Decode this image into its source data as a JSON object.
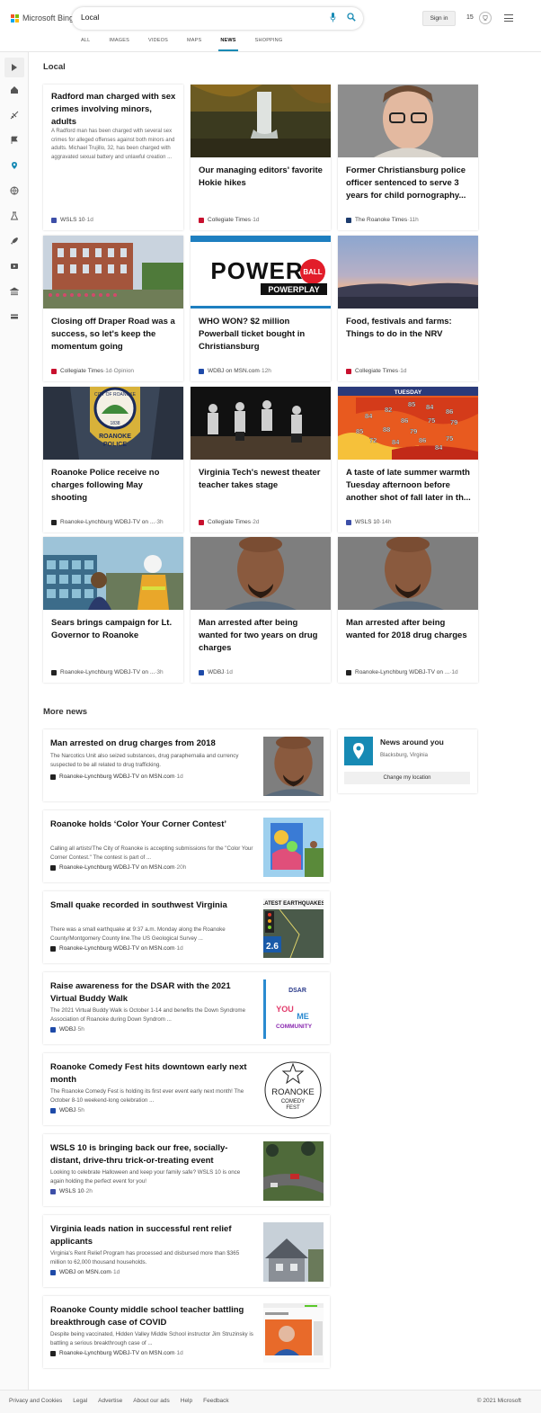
{
  "brand": {
    "name": "Microsoft Bing",
    "colors": [
      "#f35325",
      "#81bc06",
      "#05a6f0",
      "#ffba08"
    ]
  },
  "search": {
    "query": "Local"
  },
  "header": {
    "sign_in": "Sign in",
    "points": "15"
  },
  "tabs": [
    {
      "label": "ALL"
    },
    {
      "label": "IMAGES"
    },
    {
      "label": "VIDEOS"
    },
    {
      "label": "MAPS"
    },
    {
      "label": "NEWS",
      "active": true
    },
    {
      "label": "SHOPPING"
    }
  ],
  "rail_icons": [
    "expand-icon",
    "home-icon",
    "scitech-icon",
    "flag-icon",
    "location-icon",
    "globe-icon",
    "science-icon",
    "rocket-icon",
    "video-icon",
    "bank-icon",
    "money-icon"
  ],
  "local": {
    "title": "Local",
    "cards": [
      {
        "title": "Radford man charged with sex crimes involving minors, adults",
        "snippet": "A Radford man has been charged with several sex crimes for alleged offenses against both minors and adults. Michael Trujillo, 32, has been charged with aggravated sexual battery and unlawful creation ...",
        "source": "WSLS 10",
        "age": "1d",
        "logo_color": "#3d4fa8",
        "image": null
      },
      {
        "title": "Our managing editors' favorite Hokie hikes",
        "source": "Collegiate Times",
        "age": "1d",
        "logo_color": "#c8102e",
        "image": "waterfall"
      },
      {
        "title": "Former Christiansburg police officer sentenced to serve 3 years for child pornography...",
        "source": "The Roanoke Times",
        "age": "11h",
        "logo_color": "#1d3c6e",
        "image": "mugshot-glasses"
      },
      {
        "title": "Closing off Draper Road was a success, so let's keep the momentum going",
        "source": "Collegiate Times",
        "age": "1d",
        "extra": "Opinion",
        "logo_color": "#c8102e",
        "image": "street"
      },
      {
        "title": "WHO WON? $2 million Powerball ticket bought in Christiansburg",
        "source": "WDBJ on MSN.com",
        "age": "12h",
        "logo_color": "#1e4aa8",
        "image": "powerball"
      },
      {
        "title": "Food, festivals and farms: Things to do in the NRV",
        "source": "Collegiate Times",
        "age": "1d",
        "logo_color": "#c8102e",
        "image": "valley-dusk"
      },
      {
        "title": "Roanoke Police receive no charges following May shooting",
        "source": "Roanoke-Lynchburg WDBJ-TV on ...",
        "age": "3h",
        "logo_color": "#222222",
        "image": "police-patch"
      },
      {
        "title": "Virginia Tech's newest theater teacher takes stage",
        "source": "Collegiate Times",
        "age": "2d",
        "logo_color": "#c8102e",
        "image": "theater"
      },
      {
        "title": "A taste of late summer warmth Tuesday afternoon before another shot of fall later in th...",
        "source": "WSLS 10",
        "age": "14h",
        "logo_color": "#3d4fa8",
        "image": "weather-map"
      },
      {
        "title": "Sears brings campaign for Lt. Governor to Roanoke",
        "source": "Roanoke-Lynchburg WDBJ-TV on ...",
        "age": "3h",
        "logo_color": "#222222",
        "image": "construction"
      },
      {
        "title": "Man arrested after being wanted for two years on drug charges",
        "source": "WDBJ",
        "age": "1d",
        "logo_color": "#1e4aa8",
        "image": "mugshot"
      },
      {
        "title": "Man arrested after being wanted for 2018 drug charges",
        "source": "Roanoke-Lynchburg WDBJ-TV on ...",
        "age": "1d",
        "logo_color": "#222222",
        "image": "mugshot"
      }
    ],
    "powerball": {
      "word": "POWER",
      "ball": "BALL",
      "play": "POWERPLAY"
    },
    "police_patch": {
      "top": "CITY OF ROANOKE",
      "year": "1838",
      "bottom1": "ROANOKE",
      "bottom2": "POLICE"
    },
    "weather": {
      "day": "TUESDAY",
      "temps": [
        "84",
        "82",
        "85",
        "84",
        "86",
        "86",
        "75",
        "79",
        "85",
        "88",
        "79",
        "72",
        "84",
        "86",
        "75",
        "84"
      ]
    }
  },
  "more_news": {
    "title": "More news",
    "items": [
      {
        "title": "Man arrested on drug charges from 2018",
        "snippet": "The Narcotics Unit also seized substances, drug paraphernalia and currency suspected to be all related to drug trafficking.",
        "source": "Roanoke-Lynchburg WDBJ-TV on MSN.com",
        "age": "1d",
        "logo_color": "#222222",
        "thumb": "mugshot"
      },
      {
        "title": "Roanoke holds ‘Color Your Corner Contest’",
        "snippet": "Calling all artists!The City of Roanoke is accepting submissions for the \"Color Your Corner Contest.\" The contest is part of ...",
        "source": "Roanoke-Lynchburg WDBJ-TV on MSN.com",
        "age": "20h",
        "logo_color": "#222222",
        "thumb": "mural"
      },
      {
        "title": "Small quake recorded in southwest Virginia",
        "snippet": "There was a small earthquake at 9:37 a.m. Monday along the Roanoke County/Montgomery County line.The US Geological Survey ...",
        "source": "Roanoke-Lynchburg WDBJ-TV on MSN.com",
        "age": "1d",
        "logo_color": "#222222",
        "thumb": "quake",
        "thumb_text": {
          "head": "LATEST EARTHQUAKES",
          "mag": "2.6"
        }
      },
      {
        "title": "Raise awareness for the DSAR with the 2021 Virtual Buddy Walk",
        "snippet": "The 2021 Virtual Buddy Walk is October 1-14 and benefits the Down Syndrome Association of Roanoke during Down Syndrom ...",
        "source": "WDBJ",
        "age": "5h",
        "logo_color": "#1e4aa8",
        "thumb": "buddywalk",
        "thumb_text": {
          "org": "DSAR",
          "you": "YOU",
          "me": "ME",
          "community": "COMMUNITY"
        }
      },
      {
        "title": "Roanoke Comedy Fest hits downtown early next month",
        "snippet": "The Roanoke Comedy Fest is holding its first ever event early next month! The October 8-10 weekend-long celebration ...",
        "source": "WDBJ",
        "age": "5h",
        "logo_color": "#1e4aa8",
        "thumb": "comedy",
        "thumb_text": {
          "name": "ROANOKE",
          "sub": "COMEDY",
          "fest": "FEST"
        }
      },
      {
        "title": "WSLS 10 is bringing back our free, socially-distant, drive-thru trick-or-treating event",
        "snippet": "Looking to celebrate Halloween and keep your family safe? WSLS 10 is once again holding the perfect event for you!",
        "source": "WSLS 10",
        "age": "2h",
        "logo_color": "#3d4fa8",
        "thumb": "drivethru"
      },
      {
        "title": "Virginia leads nation in successful rent relief applicants",
        "snippet": "Virginia's Rent Relief Program has processed and disbursed more than $365 million to 62,000 thousand households.",
        "source": "WDBJ on MSN.com",
        "age": "1d",
        "logo_color": "#1e4aa8",
        "thumb": "house"
      },
      {
        "title": "Roanoke County middle school teacher battling breakthrough case of COVID",
        "snippet": "Despite being vaccinated, Hidden Valley Middle School instructor Jim Struzinsky is battling a serious breakthrough case of ...",
        "source": "Roanoke-Lynchburg WDBJ-TV on MSN.com",
        "age": "1d",
        "logo_color": "#222222",
        "thumb": "teacher"
      }
    ]
  },
  "location": {
    "title": "News around you",
    "place": "Blacksburg, Virginia",
    "button": "Change my location"
  },
  "footer": {
    "links": [
      "Privacy and Cookies",
      "Legal",
      "Advertise",
      "About our ads",
      "Help",
      "Feedback"
    ],
    "copyright": "© 2021 Microsoft"
  }
}
